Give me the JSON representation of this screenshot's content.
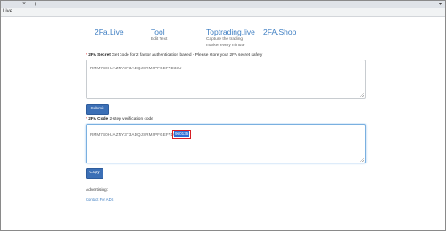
{
  "browser": {
    "tab_close": "×",
    "tab_new": "+",
    "tab_dropdown": "▾",
    "address": "Live"
  },
  "nav": [
    {
      "title": "2Fa.Live",
      "subtitle": ""
    },
    {
      "title": "Tool",
      "subtitle": "Edit Text"
    },
    {
      "title": "Toptrading.live",
      "subtitle": "Capture the trading",
      "subtitle2": "market every minute"
    },
    {
      "title": "2FA.Shop",
      "subtitle": ""
    }
  ],
  "secret": {
    "required": "*",
    "title": "2FA Secret",
    "description": "Get code for 2 factor authentication based - Please store your 2FA secret safety",
    "value": "RMM7B0HJAZNY3T3ADQJSRMJPFGEF7D33U"
  },
  "submit_label": "Submit",
  "code": {
    "required": "*",
    "title": "2FA Code",
    "description": "2-step verification code",
    "value_prefix": "RMM7B0HJAZNY3T3ADQJSRMJPFGEF7D33U|",
    "otp": "960135"
  },
  "copy_label": "Copy",
  "footer": {
    "advertising": "Advertising:",
    "contact": "Contact For ADS"
  },
  "colors": {
    "link_blue": "#3c7dc2",
    "button_blue": "#3b6fb6",
    "highlight_red": "#d61f26"
  }
}
